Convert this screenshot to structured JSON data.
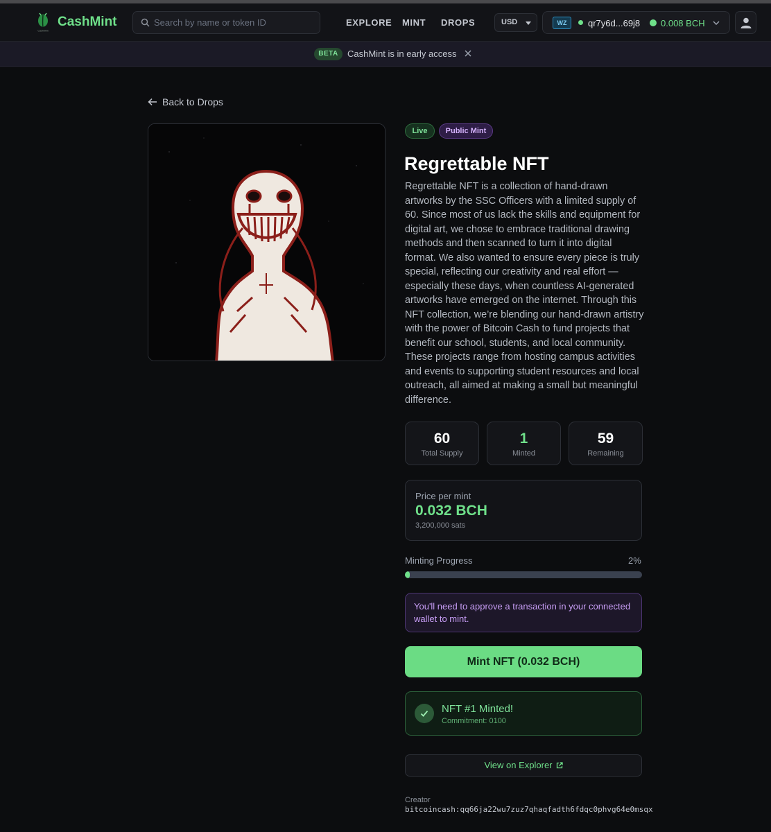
{
  "header": {
    "brand": "CashMint",
    "logo_text": "CashMint",
    "search_placeholder": "Search by name or token ID",
    "nav": [
      "EXPLORE",
      "MINT",
      "DROPS"
    ],
    "currency": "USD",
    "wallet": {
      "badge": "WZ",
      "address": "qr7y6d...69j8",
      "balance": "0.008 BCH"
    }
  },
  "banner": {
    "badge": "BETA",
    "text": "CashMint is in early access"
  },
  "back_label": "Back to Drops",
  "drop": {
    "badges": [
      "Live",
      "Public Mint"
    ],
    "title": "Regrettable NFT",
    "description": "Regrettable NFT is a collection of hand-drawn artworks by the SSC Officers with a limited supply of 60. Since most of us lack the skills and equipment for digital art, we chose to embrace traditional drawing methods and then scanned to turn it into digital format. We also wanted to ensure every piece is truly special, reflecting our creativity and real effort —especially these days, when countless AI-generated artworks have emerged on the internet. Through this NFT collection, we’re blending our hand-drawn artistry with the power of Bitcoin Cash to fund projects that benefit our school, students, and local community. These projects range from hosting campus activities and events to supporting student resources and local outreach, all aimed at making a small but meaningful difference.",
    "stats": [
      {
        "value": "60",
        "label": "Total Supply"
      },
      {
        "value": "1",
        "label": "Minted"
      },
      {
        "value": "59",
        "label": "Remaining"
      }
    ],
    "price": {
      "label": "Price per mint",
      "value": "0.032 BCH",
      "sats": "3,200,000 sats"
    },
    "progress": {
      "label": "Minting Progress",
      "percent_text": "2%",
      "fraction": 0.02
    },
    "notice": "You'll need to approve a transaction in your connected wallet to mint.",
    "mint_button": "Mint NFT (0.032 BCH)",
    "success": {
      "title": "NFT #1 Minted!",
      "commitment": "Commitment: 0100"
    },
    "explorer_link": "View on Explorer",
    "creator": {
      "label": "Creator",
      "address": "bitcoincash:qq66ja22wu7zuz7qhaqfadth6fdqc0phvg64e0msqx"
    }
  },
  "colors": {
    "accent": "#6fe08a",
    "background": "#0c0d0f",
    "purple": "#c89ef6"
  },
  "icons": [
    "cashmint-logo-icon",
    "search-icon",
    "chevron-down-icon",
    "user-icon",
    "close-icon",
    "arrow-left-icon",
    "check-icon",
    "external-link-icon"
  ]
}
